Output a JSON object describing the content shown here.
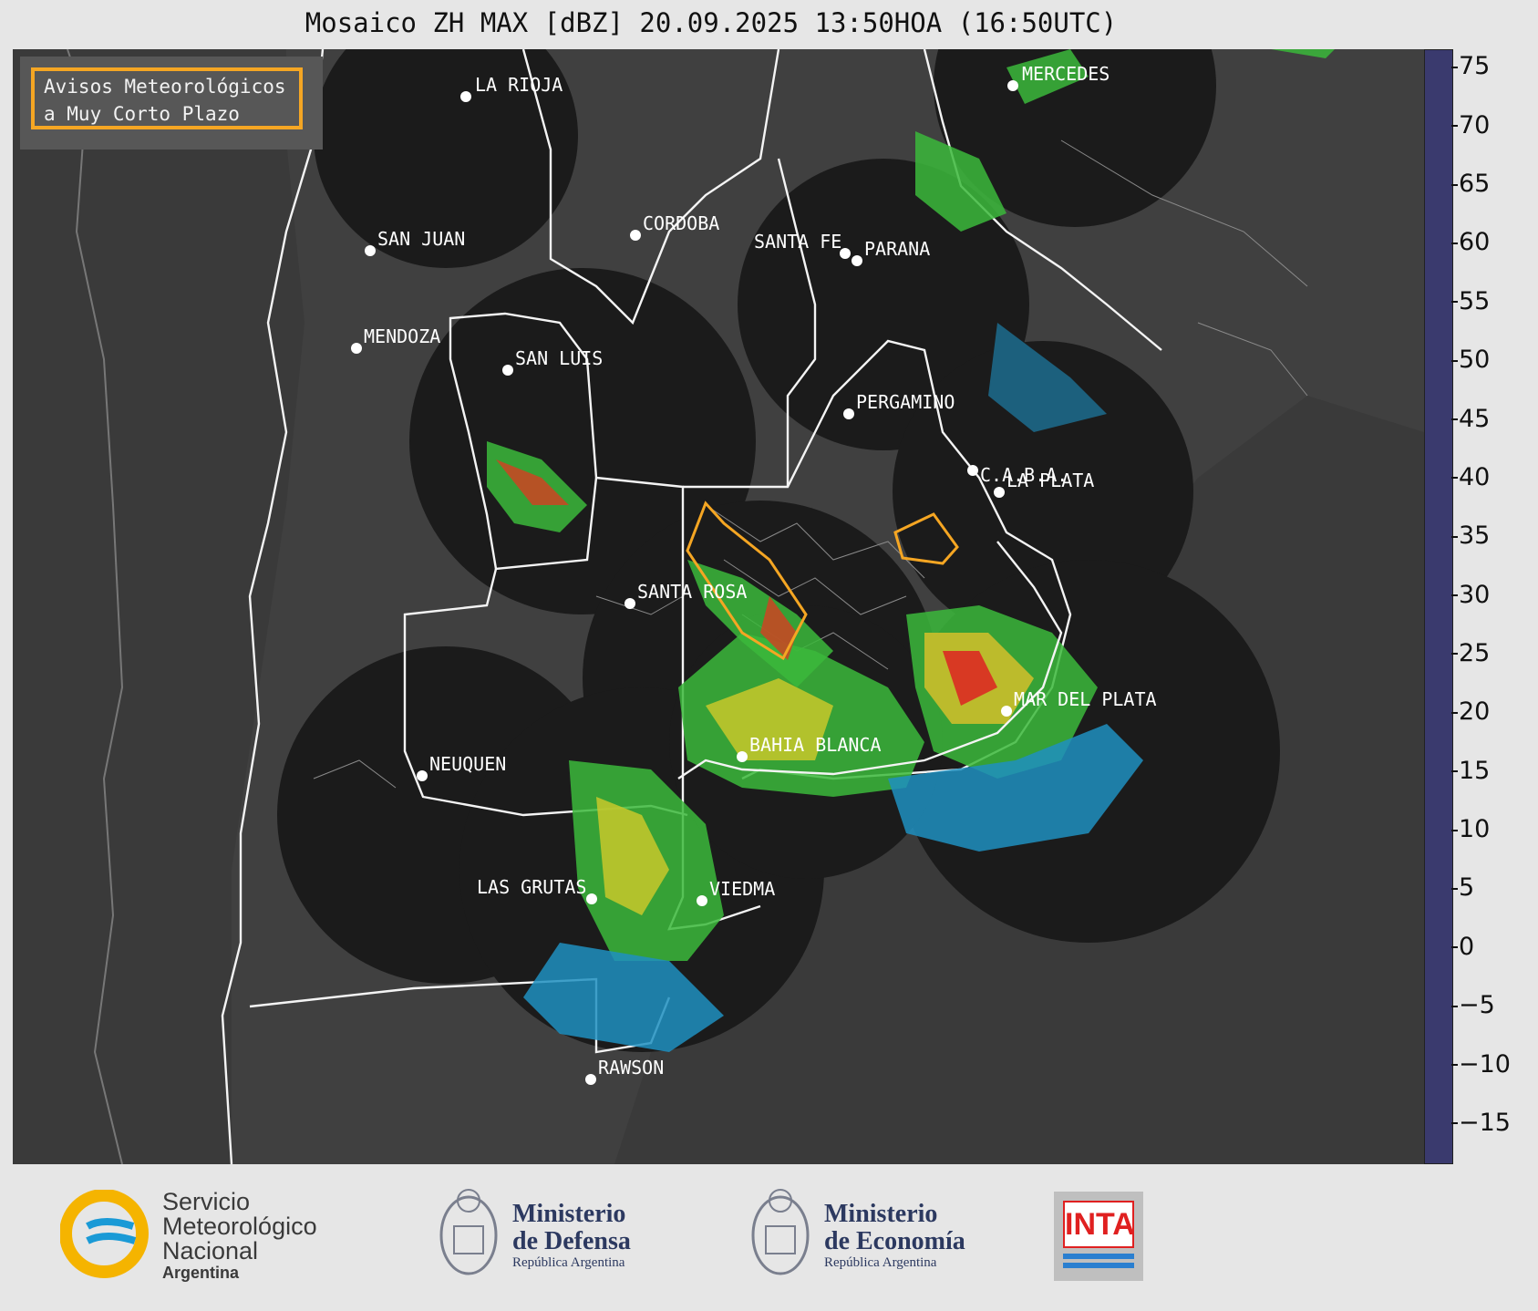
{
  "title": "Mosaico ZH MAX [dBZ] 20.09.2025 13:50HOA (16:50UTC)",
  "legend": {
    "line1": "Avisos Meteorológicos",
    "line2": "a Muy Corto Plazo",
    "color": "#f5a623"
  },
  "colorbar": {
    "unit": "dBZ",
    "ticks": [
      "75",
      "70",
      "65",
      "60",
      "55",
      "50",
      "45",
      "40",
      "35",
      "30",
      "25",
      "20",
      "15",
      "10",
      "5",
      "0",
      "−5",
      "−10",
      "−15"
    ],
    "range": [
      -18.5,
      76.5
    ]
  },
  "cities": [
    {
      "name": "LA RIOJA"
    },
    {
      "name": "MERCEDES"
    },
    {
      "name": "SAN JUAN"
    },
    {
      "name": "CORDOBA"
    },
    {
      "name": "SANTA FE"
    },
    {
      "name": "PARANA"
    },
    {
      "name": "MENDOZA"
    },
    {
      "name": "SAN LUIS"
    },
    {
      "name": "PERGAMINO"
    },
    {
      "name": "C.A.B.A."
    },
    {
      "name": "LA PLATA"
    },
    {
      "name": "SANTA ROSA"
    },
    {
      "name": "MAR DEL PLATA"
    },
    {
      "name": "BAHIA BLANCA"
    },
    {
      "name": "NEUQUEN"
    },
    {
      "name": "LAS GRUTAS"
    },
    {
      "name": "VIEDMA"
    },
    {
      "name": "RAWSON"
    }
  ],
  "footer": {
    "smn": {
      "line1": "Servicio",
      "line2": "Meteorológico",
      "line3": "Nacional",
      "sub": "Argentina"
    },
    "defensa": {
      "line1": "Ministerio",
      "line2": "de Defensa",
      "sub": "República Argentina"
    },
    "economia": {
      "line1": "Ministerio",
      "line2": "de Economía",
      "sub": "República Argentina"
    },
    "inta": {
      "label": "INTA"
    }
  }
}
